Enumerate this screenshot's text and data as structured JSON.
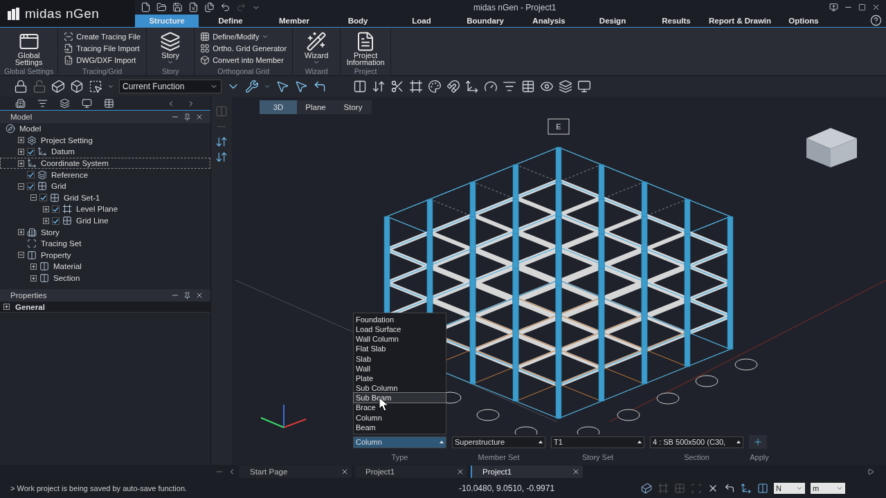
{
  "window": {
    "app_name": "midas nGen",
    "title": "midas nGen - Project1"
  },
  "menu_tabs": [
    {
      "label": "Structure",
      "selected": true
    },
    {
      "label": "Define",
      "selected": false
    },
    {
      "label": "Member",
      "selected": false
    },
    {
      "label": "Body",
      "selected": false
    },
    {
      "label": "Load",
      "selected": false
    },
    {
      "label": "Boundary",
      "selected": false
    },
    {
      "label": "Analysis",
      "selected": false
    },
    {
      "label": "Design",
      "selected": false
    },
    {
      "label": "Results",
      "selected": false
    },
    {
      "label": "Report & Drawin",
      "selected": false
    },
    {
      "label": "Options",
      "selected": false
    }
  ],
  "ribbon": {
    "groups": [
      {
        "kind": "large",
        "title": "Global Settings",
        "buttons": [
          {
            "label": "Global Settings",
            "dropdown": false
          }
        ]
      },
      {
        "kind": "small",
        "title": "Tracing/Grid",
        "buttons": [
          {
            "label": "Create Tracing File",
            "dropdown": false
          },
          {
            "label": "Tracing File Import",
            "dropdown": false
          },
          {
            "label": "DWG/DXF Import",
            "dropdown": false
          }
        ]
      },
      {
        "kind": "large",
        "title": "Story",
        "buttons": [
          {
            "label": "Story",
            "dropdown": true
          }
        ]
      },
      {
        "kind": "small",
        "title": "Orthogonal Grid",
        "buttons": [
          {
            "label": "Define/Modify",
            "dropdown": true
          },
          {
            "label": "Ortho. Grid Generator",
            "dropdown": false
          },
          {
            "label": "Convert into Member",
            "dropdown": false
          }
        ]
      },
      {
        "kind": "large",
        "title": "Wizard",
        "buttons": [
          {
            "label": "Wizard",
            "dropdown": true
          }
        ]
      },
      {
        "kind": "large",
        "title": "Project",
        "buttons": [
          {
            "label": "Project Information",
            "dropdown": false
          }
        ]
      }
    ]
  },
  "toolbar": {
    "function_select": "Current Function"
  },
  "model_pane": {
    "title": "Model",
    "tree": [
      {
        "label": "Model",
        "focused": false,
        "children": [
          {
            "label": "Project Setting",
            "expanded": false,
            "focused": false
          },
          {
            "label": "Datum",
            "expanded": false,
            "checked": true,
            "focused": false
          },
          {
            "label": "Coordinate System",
            "expanded": false,
            "focused": true
          },
          {
            "label": "Reference",
            "checked": true,
            "focused": false
          },
          {
            "label": "Grid",
            "expanded": true,
            "checked": true,
            "focused": false,
            "children": [
              {
                "label": "Grid Set-1",
                "expanded": true,
                "checked": true,
                "focused": false,
                "children": [
                  {
                    "label": "Level Plane",
                    "expanded": false,
                    "checked": true,
                    "focused": false
                  },
                  {
                    "label": "Grid Line",
                    "expanded": false,
                    "checked": true,
                    "focused": false
                  }
                ]
              }
            ]
          },
          {
            "label": "Story",
            "expanded": false,
            "focused": false
          },
          {
            "label": "Tracing Set",
            "focused": false
          },
          {
            "label": "Property",
            "expanded": true,
            "focused": false,
            "children": [
              {
                "label": "Material",
                "expanded": false,
                "focused": false
              },
              {
                "label": "Section",
                "expanded": false,
                "focused": false
              }
            ]
          }
        ]
      }
    ]
  },
  "properties_pane": {
    "title": "Properties",
    "sections": [
      {
        "label": "General",
        "expanded": false
      }
    ]
  },
  "view_tabs": [
    {
      "label": "3D",
      "selected": true
    },
    {
      "label": "Plane",
      "selected": false
    },
    {
      "label": "Story",
      "selected": false
    }
  ],
  "viewport": {
    "grid_label": "E"
  },
  "type_menu": {
    "items": [
      {
        "label": "Foundation",
        "selected": false
      },
      {
        "label": "Load Surface",
        "selected": false
      },
      {
        "label": "Wall Column",
        "selected": false
      },
      {
        "label": "Flat Slab",
        "selected": false
      },
      {
        "label": "Slab",
        "selected": false
      },
      {
        "label": "Wall",
        "selected": false
      },
      {
        "label": "Plate",
        "selected": false
      },
      {
        "label": "Sub Column",
        "selected": false
      },
      {
        "label": "Sub Beam",
        "selected": true
      },
      {
        "label": "Brace",
        "selected": false
      },
      {
        "label": "Column",
        "selected": false
      },
      {
        "label": "Beam",
        "selected": false
      }
    ]
  },
  "member_bar": {
    "fields": [
      {
        "label": "Type",
        "value": "Column",
        "active": true
      },
      {
        "label": "Member Set",
        "value": "Superstructure",
        "active": false
      },
      {
        "label": "Story Set",
        "value": "T1",
        "active": false
      },
      {
        "label": "Section",
        "value": "4 : SB 500x500 (C30,",
        "active": false
      }
    ],
    "apply": "Apply"
  },
  "document_tabs": [
    {
      "label": "Start Page",
      "selected": false
    },
    {
      "label": "Project1",
      "selected": false
    },
    {
      "label": "Project1",
      "selected": true
    }
  ],
  "status_bar": {
    "message": "> Work project is being saved by auto-save function.",
    "coordinates": "-10.0480, 9.0510, -0.9971",
    "force_unit": "N",
    "length_unit": "m"
  }
}
